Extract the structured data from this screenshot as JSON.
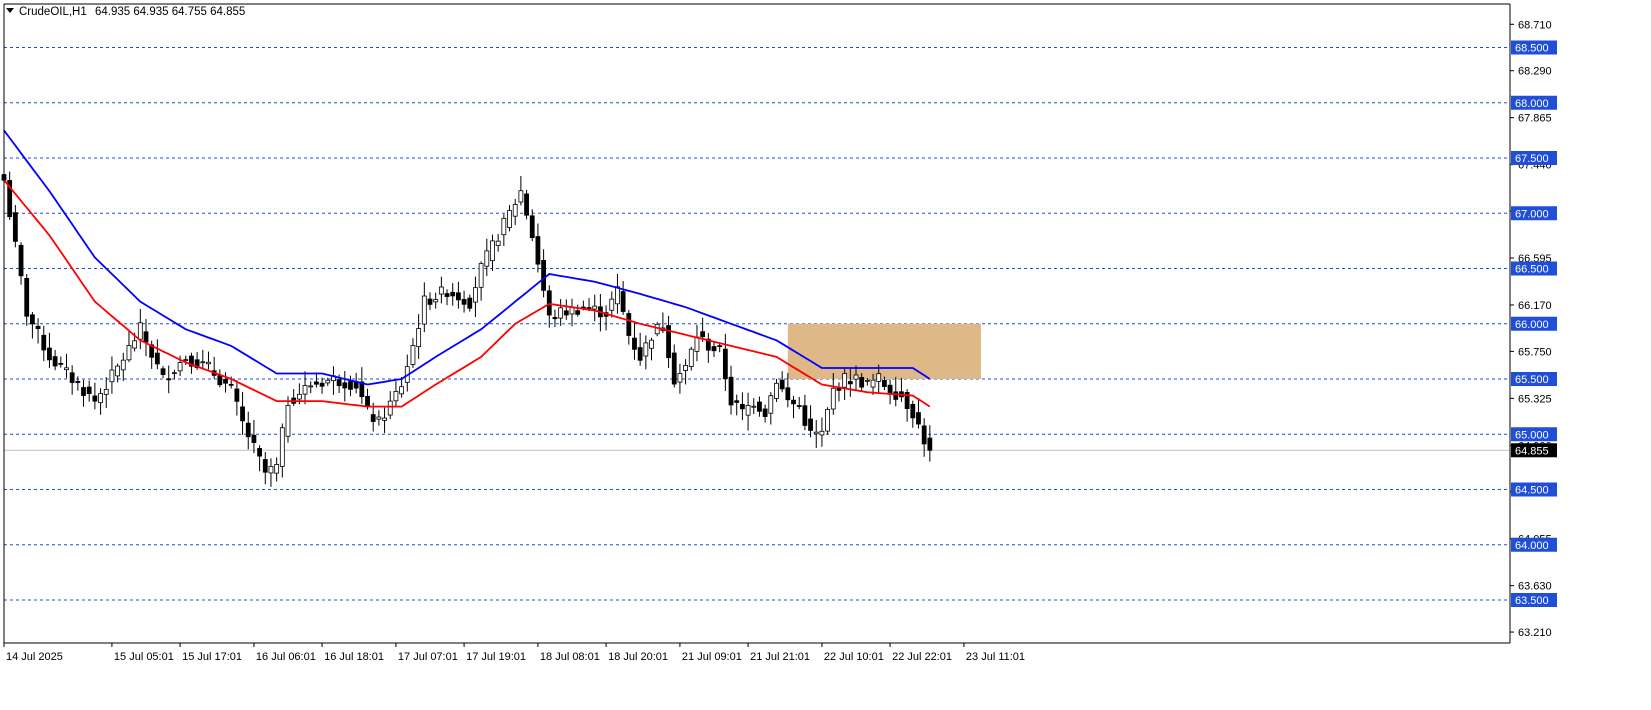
{
  "header": {
    "symbol_label": "CrudeOIL,H1",
    "ohlc_label": "64.935 64.935 64.755 64.855"
  },
  "colors": {
    "background": "#ffffff",
    "axis": "#000000",
    "level_line": "#1f4fd6",
    "level_badge": "#1f4fd6",
    "ema_fast": "#ff0000",
    "ema_slow": "#0000ff",
    "zone_fill": "#deb887",
    "bull_body": "#ffffff",
    "bear_body": "#000000",
    "current_badge": "#000000",
    "current_line": "#c0c0c0"
  },
  "chart_data": {
    "type": "candlestick",
    "symbol": "CrudeOIL",
    "timeframe": "H1",
    "ylim": [
      63.0,
      68.9
    ],
    "current_price": 64.855,
    "current_price_label": "64.855",
    "y_ticks": [
      {
        "value": 68.71,
        "label": "68.710"
      },
      {
        "value": 68.29,
        "label": "68.290"
      },
      {
        "value": 67.865,
        "label": "67.865"
      },
      {
        "value": 67.44,
        "label": "67.440"
      },
      {
        "value": 67.02,
        "label": "67.020"
      },
      {
        "value": 66.595,
        "label": "66.595"
      },
      {
        "value": 66.17,
        "label": "66.170"
      },
      {
        "value": 65.75,
        "label": "65.750"
      },
      {
        "value": 65.325,
        "label": "65.325"
      },
      {
        "value": 64.9,
        "label": "64.900"
      },
      {
        "value": 64.48,
        "label": "64.480"
      },
      {
        "value": 64.055,
        "label": "64.055"
      },
      {
        "value": 63.63,
        "label": "63.630"
      },
      {
        "value": 63.21,
        "label": "63.210"
      }
    ],
    "levels": [
      {
        "value": 68.5,
        "label": "68.500"
      },
      {
        "value": 68.0,
        "label": "68.000"
      },
      {
        "value": 67.5,
        "label": "67.500"
      },
      {
        "value": 67.0,
        "label": "67.000"
      },
      {
        "value": 66.5,
        "label": "66.500"
      },
      {
        "value": 66.0,
        "label": "66.000"
      },
      {
        "value": 65.5,
        "label": "65.500"
      },
      {
        "value": 65.0,
        "label": "65.000"
      },
      {
        "value": 64.5,
        "label": "64.500"
      },
      {
        "value": 64.0,
        "label": "64.000"
      },
      {
        "value": 63.5,
        "label": "63.500"
      }
    ],
    "x_labels": [
      {
        "index": 0,
        "label": "14 Jul 2025"
      },
      {
        "index": 19,
        "label": "15 Jul 05:01"
      },
      {
        "index": 31,
        "label": "15 Jul 17:01"
      },
      {
        "index": 44,
        "label": "16 Jul 06:01"
      },
      {
        "index": 56,
        "label": "16 Jul 18:01"
      },
      {
        "index": 69,
        "label": "17 Jul 07:01"
      },
      {
        "index": 81,
        "label": "17 Jul 19:01"
      },
      {
        "index": 94,
        "label": "18 Jul 08:01"
      },
      {
        "index": 106,
        "label": "18 Jul 20:01"
      },
      {
        "index": 119,
        "label": "21 Jul 09:01"
      },
      {
        "index": 131,
        "label": "21 Jul 21:01"
      },
      {
        "index": 144,
        "label": "22 Jul 10:01"
      },
      {
        "index": 156,
        "label": "22 Jul 22:01"
      },
      {
        "index": 169,
        "label": "23 Jul 11:01"
      }
    ],
    "zone": {
      "start_index": 138,
      "end_index": 172,
      "top": 66.0,
      "bottom": 65.5
    },
    "close_anchors": [
      [
        0,
        67.3
      ],
      [
        4,
        66.1
      ],
      [
        8,
        65.7
      ],
      [
        12,
        65.5
      ],
      [
        16,
        65.3
      ],
      [
        20,
        65.6
      ],
      [
        24,
        65.95
      ],
      [
        28,
        65.5
      ],
      [
        32,
        65.7
      ],
      [
        36,
        65.6
      ],
      [
        40,
        65.4
      ],
      [
        42,
        65.1
      ],
      [
        46,
        64.65
      ],
      [
        48,
        64.7
      ],
      [
        50,
        65.3
      ],
      [
        54,
        65.45
      ],
      [
        58,
        65.5
      ],
      [
        62,
        65.45
      ],
      [
        64,
        65.2
      ],
      [
        66,
        65.1
      ],
      [
        70,
        65.45
      ],
      [
        72,
        65.8
      ],
      [
        74,
        66.2
      ],
      [
        78,
        66.3
      ],
      [
        82,
        66.2
      ],
      [
        84,
        66.5
      ],
      [
        88,
        66.9
      ],
      [
        91,
        67.2
      ],
      [
        93,
        66.8
      ],
      [
        95,
        66.3
      ],
      [
        96,
        66.05
      ],
      [
        98,
        66.1
      ],
      [
        102,
        66.15
      ],
      [
        106,
        66.1
      ],
      [
        108,
        66.3
      ],
      [
        110,
        65.9
      ],
      [
        112,
        65.7
      ],
      [
        114,
        65.9
      ],
      [
        116,
        66.0
      ],
      [
        118,
        65.5
      ],
      [
        120,
        65.6
      ],
      [
        122,
        65.9
      ],
      [
        124,
        65.8
      ],
      [
        126,
        65.75
      ],
      [
        128,
        65.3
      ],
      [
        130,
        65.2
      ],
      [
        132,
        65.3
      ],
      [
        134,
        65.2
      ],
      [
        136,
        65.5
      ],
      [
        138,
        65.3
      ],
      [
        140,
        65.25
      ],
      [
        142,
        65.0
      ],
      [
        144,
        65.0
      ],
      [
        146,
        65.4
      ],
      [
        148,
        65.5
      ],
      [
        150,
        65.5
      ],
      [
        152,
        65.45
      ],
      [
        154,
        65.5
      ],
      [
        156,
        65.4
      ],
      [
        158,
        65.35
      ],
      [
        160,
        65.2
      ],
      [
        162,
        64.95
      ],
      [
        163,
        64.855
      ]
    ],
    "ema_fast": {
      "period": 20,
      "anchors": [
        [
          0,
          67.3
        ],
        [
          8,
          66.8
        ],
        [
          16,
          66.2
        ],
        [
          24,
          65.85
        ],
        [
          32,
          65.65
        ],
        [
          40,
          65.5
        ],
        [
          48,
          65.3
        ],
        [
          56,
          65.3
        ],
        [
          64,
          65.25
        ],
        [
          70,
          65.25
        ],
        [
          76,
          65.45
        ],
        [
          84,
          65.7
        ],
        [
          90,
          66.0
        ],
        [
          96,
          66.18
        ],
        [
          104,
          66.12
        ],
        [
          112,
          66.0
        ],
        [
          120,
          65.9
        ],
        [
          128,
          65.8
        ],
        [
          136,
          65.7
        ],
        [
          144,
          65.45
        ],
        [
          152,
          65.38
        ],
        [
          160,
          65.35
        ],
        [
          163,
          65.25
        ]
      ]
    },
    "ema_slow": {
      "period": 50,
      "anchors": [
        [
          0,
          67.75
        ],
        [
          8,
          67.2
        ],
        [
          16,
          66.6
        ],
        [
          24,
          66.2
        ],
        [
          32,
          65.95
        ],
        [
          40,
          65.8
        ],
        [
          48,
          65.55
        ],
        [
          56,
          65.55
        ],
        [
          64,
          65.45
        ],
        [
          70,
          65.5
        ],
        [
          76,
          65.7
        ],
        [
          84,
          65.95
        ],
        [
          90,
          66.2
        ],
        [
          96,
          66.45
        ],
        [
          104,
          66.38
        ],
        [
          112,
          66.27
        ],
        [
          120,
          66.15
        ],
        [
          128,
          66.0
        ],
        [
          136,
          65.85
        ],
        [
          144,
          65.6
        ],
        [
          152,
          65.6
        ],
        [
          160,
          65.6
        ],
        [
          163,
          65.5
        ]
      ]
    },
    "candle_count": 164
  }
}
